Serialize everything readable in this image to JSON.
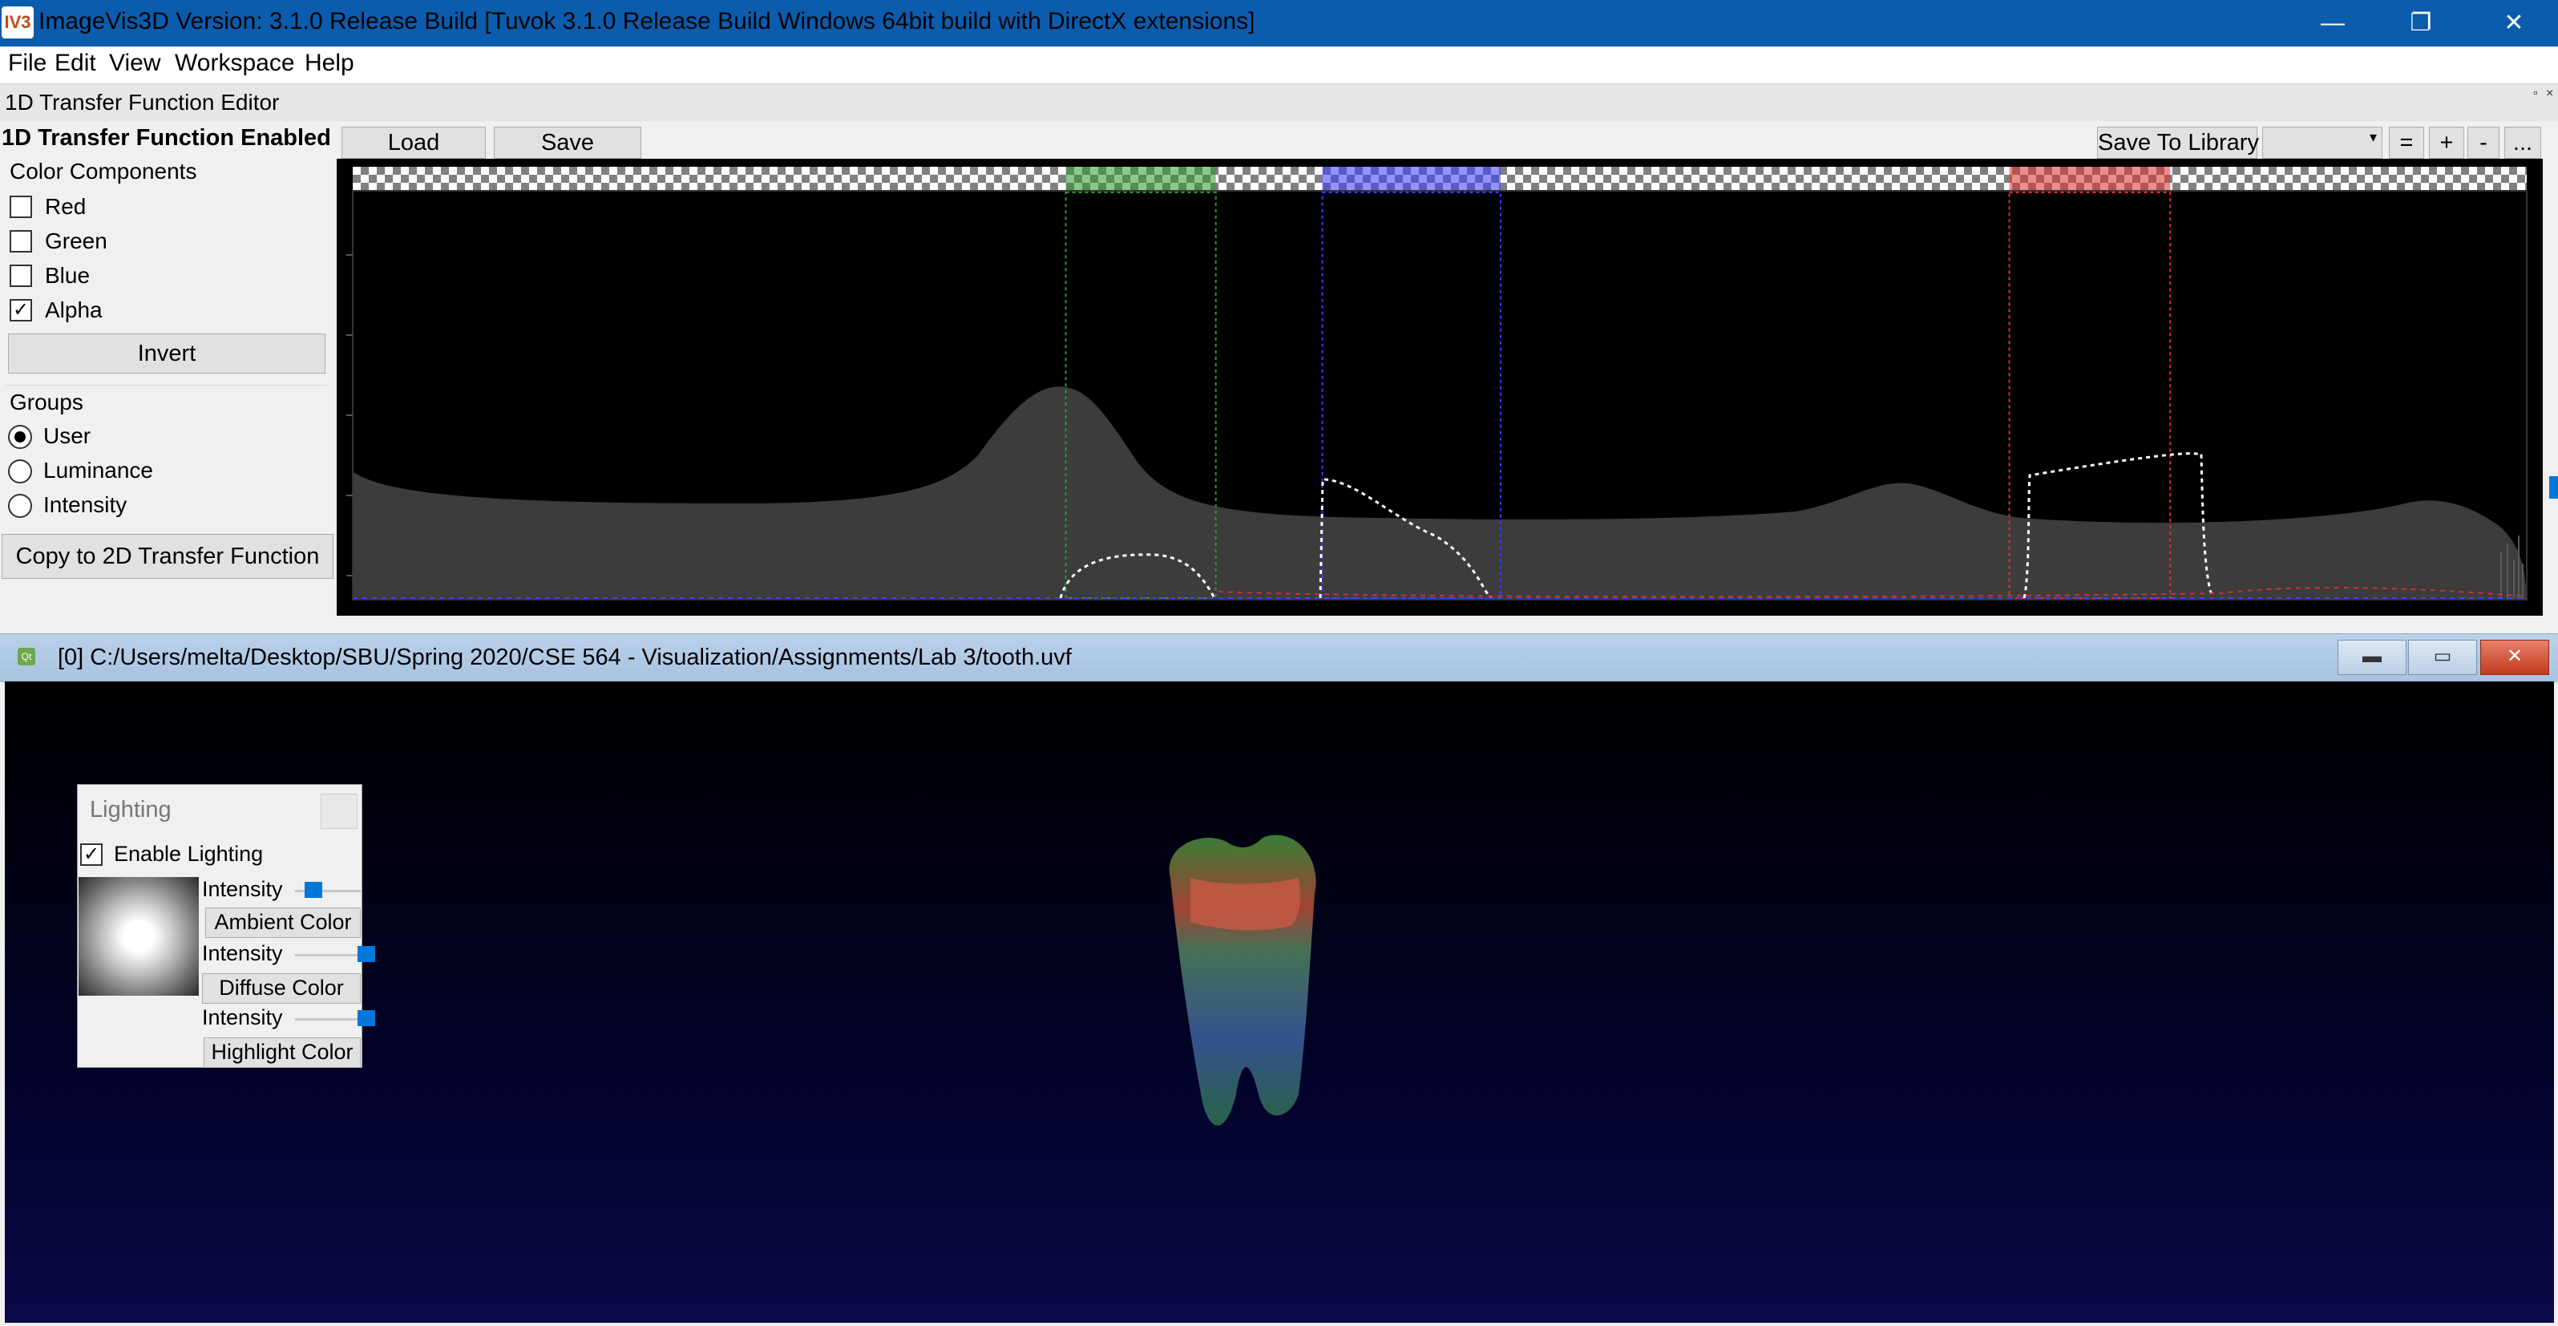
{
  "window": {
    "title": "ImageVis3D Version: 3.1.0 Release Build [Tuvok 3.1.0 Release Build Windows 64bit build with DirectX extensions]",
    "app_icon_label": "IV3",
    "controls": {
      "minimize": "—",
      "restore": "❐",
      "close": "✕"
    }
  },
  "menu": {
    "items": [
      "File",
      "Edit",
      "View",
      "Workspace",
      "Help"
    ]
  },
  "tf_editor": {
    "title": "1D Transfer Function Editor",
    "enabled_label": "1D Transfer Function Enabled",
    "load_label": "Load",
    "save_label": "Save",
    "save_library_label": "Save To Library",
    "library_value": "",
    "buttons": {
      "eq": "=",
      "plus": "+",
      "minus": "-",
      "more": "..."
    },
    "color_components_label": "Color Components",
    "components": [
      {
        "label": "Red",
        "checked": false
      },
      {
        "label": "Green",
        "checked": false
      },
      {
        "label": "Blue",
        "checked": false
      },
      {
        "label": "Alpha",
        "checked": true
      }
    ],
    "invert_label": "Invert",
    "groups_label": "Groups",
    "groups": [
      {
        "label": "User",
        "selected": true
      },
      {
        "label": "Luminance",
        "selected": false
      },
      {
        "label": "Intensity",
        "selected": false
      }
    ],
    "copy_2d_label": "Copy to 2D Transfer Function",
    "ranges": [
      {
        "channel": "green",
        "color": "#2e9b2e",
        "start": 0.328,
        "end": 0.397
      },
      {
        "channel": "blue",
        "color": "#3a3aff",
        "start": 0.446,
        "end": 0.528
      },
      {
        "channel": "red",
        "color": "#e03030",
        "start": 0.762,
        "end": 0.836
      }
    ]
  },
  "view_window": {
    "title": "[0] C:/Users/melta/Desktop/SBU/Spring 2020/CSE 564 - Visualization/Assignments/Lab 3/tooth.uvf",
    "icon_label": "Qt",
    "controls": {
      "minimize": "▬",
      "maximize": "▭",
      "close": "✕"
    }
  },
  "lighting": {
    "title": "Lighting",
    "enable_label": "Enable Lighting",
    "enabled": true,
    "rows": [
      {
        "intensity_label": "Intensity",
        "intensity": 0.2,
        "button": "Ambient Color"
      },
      {
        "intensity_label": "Intensity",
        "intensity": 0.95,
        "button": "Diffuse Color"
      },
      {
        "intensity_label": "Intensity",
        "intensity": 0.95,
        "button": "Highlight Color"
      }
    ]
  },
  "colors": {
    "titlebar": "#0b5cad",
    "accent": "#0078d7"
  }
}
